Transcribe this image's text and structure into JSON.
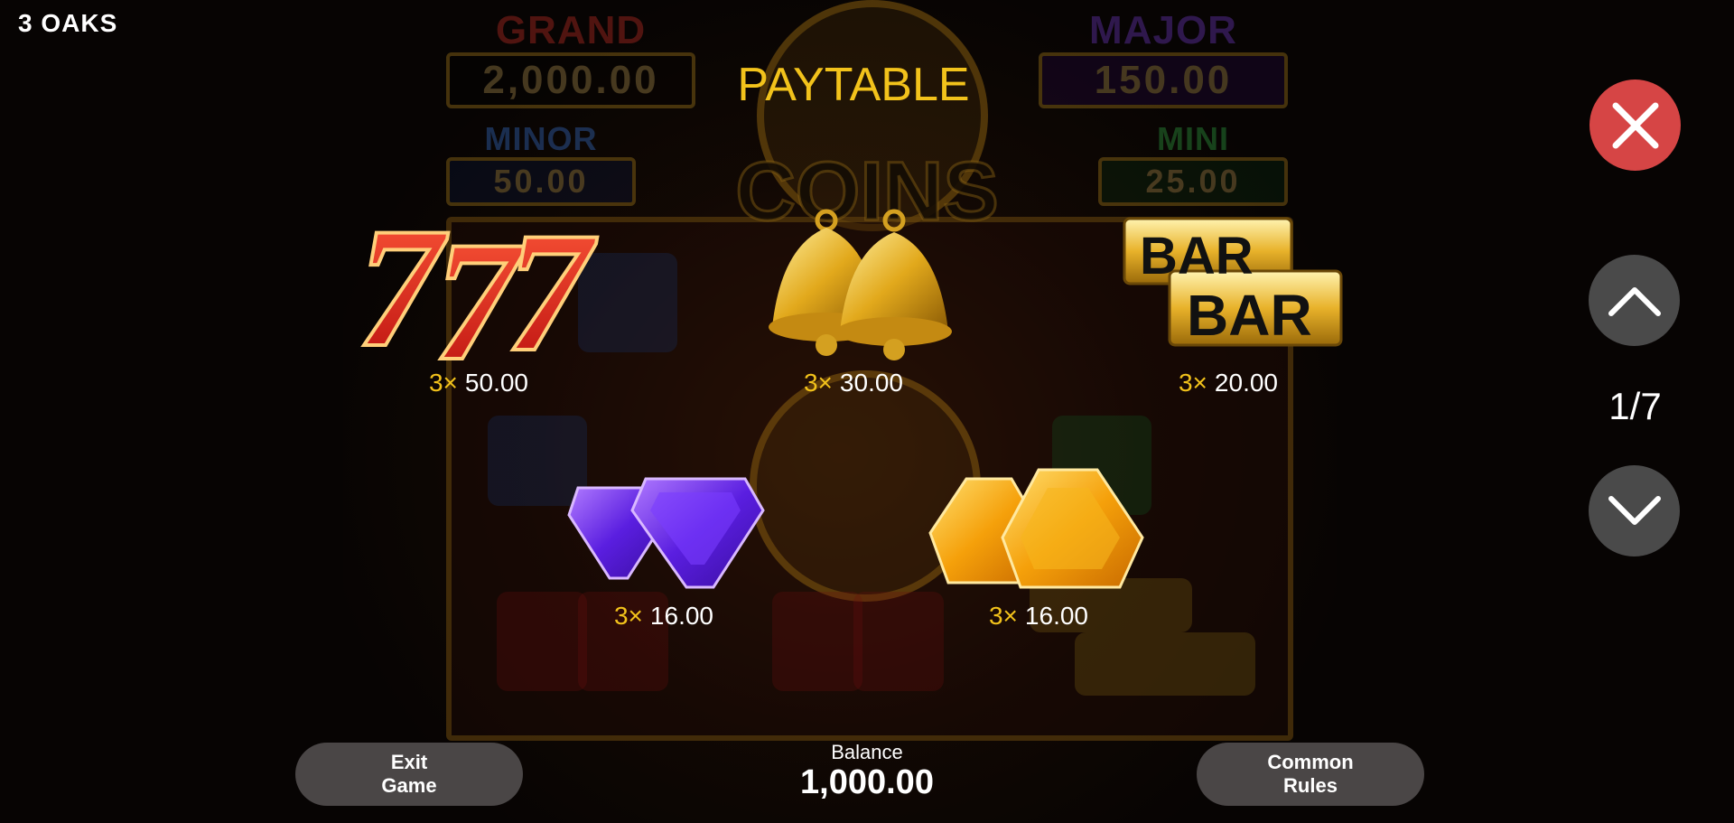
{
  "header": {
    "game_title": "3 OAKS",
    "paytable_title": "PAYTABLE"
  },
  "background": {
    "jackpots": [
      {
        "label": "GRAND",
        "value": "2,000.00",
        "color": "#d8322a"
      },
      {
        "label": "MAJOR",
        "value": "150.00",
        "color": "#7a3fd8"
      },
      {
        "label": "MINOR",
        "value": "50.00",
        "color": "#3c7be0"
      },
      {
        "label": "MINI",
        "value": "25.00",
        "color": "#34b54a"
      }
    ],
    "logo_text": "COINS"
  },
  "paytable": [
    {
      "symbol": "triple-seven",
      "multiplier": "3×",
      "value": "50.00"
    },
    {
      "symbol": "bells",
      "multiplier": "3×",
      "value": "30.00"
    },
    {
      "symbol": "bar-bar",
      "multiplier": "3×",
      "value": "20.00",
      "bar_text": "BAR"
    },
    {
      "symbol": "purple-gems",
      "multiplier": "3×",
      "value": "16.00"
    },
    {
      "symbol": "orange-gems",
      "multiplier": "3×",
      "value": "16.00"
    }
  ],
  "controls": {
    "close_icon": "close-icon",
    "up_icon": "chevron-up-icon",
    "down_icon": "chevron-down-icon",
    "page_indicator": "1/7"
  },
  "footer": {
    "exit_line1": "Exit",
    "exit_line2": "Game",
    "rules_line1": "Common",
    "rules_line2": "Rules",
    "balance_label": "Balance",
    "balance_value": "1,000.00"
  },
  "colors": {
    "accent_yellow": "#f2c21b",
    "close_red": "#d64545",
    "button_gray": "#4a4a4a"
  }
}
